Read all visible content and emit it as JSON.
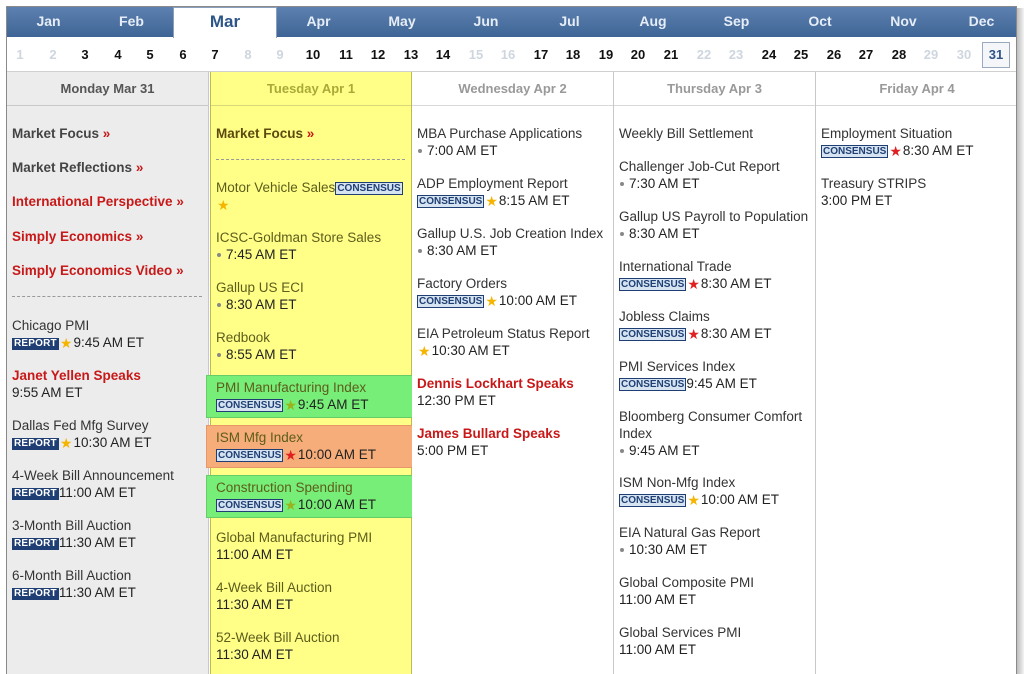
{
  "months": [
    {
      "label": "Jan",
      "active": false
    },
    {
      "label": "Feb",
      "active": false
    },
    {
      "label": "Mar",
      "active": true
    },
    {
      "label": "Apr",
      "active": false
    },
    {
      "label": "May",
      "active": false
    },
    {
      "label": "Jun",
      "active": false
    },
    {
      "label": "Jul",
      "active": false
    },
    {
      "label": "Aug",
      "active": false
    },
    {
      "label": "Sep",
      "active": false
    },
    {
      "label": "Oct",
      "active": false
    },
    {
      "label": "Nov",
      "active": false
    },
    {
      "label": "Dec",
      "active": false
    }
  ],
  "day_numbers": [
    {
      "n": "1",
      "muted": true
    },
    {
      "n": "2",
      "muted": true
    },
    {
      "n": "3"
    },
    {
      "n": "4"
    },
    {
      "n": "5"
    },
    {
      "n": "6"
    },
    {
      "n": "7"
    },
    {
      "n": "8",
      "muted": true
    },
    {
      "n": "9",
      "muted": true
    },
    {
      "n": "10"
    },
    {
      "n": "11"
    },
    {
      "n": "12"
    },
    {
      "n": "13"
    },
    {
      "n": "14"
    },
    {
      "n": "15",
      "muted": true
    },
    {
      "n": "16",
      "muted": true
    },
    {
      "n": "17"
    },
    {
      "n": "18"
    },
    {
      "n": "19"
    },
    {
      "n": "20"
    },
    {
      "n": "21"
    },
    {
      "n": "22",
      "muted": true
    },
    {
      "n": "23",
      "muted": true
    },
    {
      "n": "24"
    },
    {
      "n": "25"
    },
    {
      "n": "26"
    },
    {
      "n": "27"
    },
    {
      "n": "28"
    },
    {
      "n": "29",
      "muted": true
    },
    {
      "n": "30",
      "muted": true
    },
    {
      "n": "31",
      "selected": true
    }
  ],
  "arrow": "»",
  "monday": {
    "header": "Monday Mar 31",
    "links": [
      {
        "label": "Market Focus",
        "red": false
      },
      {
        "label": "Market Reflections",
        "red": false
      },
      {
        "label": "International Perspective",
        "red": true
      },
      {
        "label": "Simply Economics",
        "red": true
      },
      {
        "label": "Simply Economics Video",
        "red": true
      }
    ],
    "events": [
      {
        "title": "Chicago PMI",
        "tag": "REPORT",
        "star": "gold",
        "time": "9:45 AM ET"
      },
      {
        "title": "Janet Yellen Speaks",
        "red": true,
        "time": "9:55 AM ET"
      },
      {
        "title": "Dallas Fed Mfg Survey",
        "tag": "REPORT",
        "star": "gold",
        "time": "10:30 AM ET"
      },
      {
        "title": "4-Week Bill Announcement",
        "tag": "REPORT",
        "time": "11:00 AM ET"
      },
      {
        "title": "3-Month Bill Auction",
        "tag": "REPORT",
        "time": "11:30 AM ET"
      },
      {
        "title": "6-Month Bill Auction",
        "tag": "REPORT",
        "time": "11:30 AM ET"
      }
    ]
  },
  "tuesday": {
    "header": "Tuesday Apr 1",
    "link": "Market Focus",
    "events": [
      {
        "title": "Motor Vehicle Sales",
        "tag": "CONSENSUS",
        "star": "gold"
      },
      {
        "title": "ICSC-Goldman Store Sales",
        "dot": true,
        "time": "7:45 AM ET"
      },
      {
        "title": "Gallup US ECI",
        "dot": true,
        "time": "8:30 AM ET"
      },
      {
        "title": "Redbook",
        "dot": true,
        "time": "8:55 AM ET"
      },
      {
        "title": "PMI Manufacturing Index",
        "tag": "CONSENSUS",
        "star": "green",
        "time": "9:45 AM ET",
        "highlight": "green"
      },
      {
        "title": "ISM Mfg Index",
        "tag": "CONSENSUS",
        "star": "red",
        "time": "10:00 AM ET",
        "highlight": "orange"
      },
      {
        "title": "Construction Spending",
        "tag": "CONSENSUS",
        "star": "green",
        "time": "10:00 AM ET",
        "highlight": "green"
      },
      {
        "title": "Global Manufacturing PMI",
        "time": "11:00 AM ET"
      },
      {
        "title": "4-Week Bill Auction",
        "time": "11:30 AM ET"
      },
      {
        "title": "52-Week Bill Auction",
        "time": "11:30 AM ET"
      }
    ]
  },
  "wednesday": {
    "header": "Wednesday Apr 2",
    "events": [
      {
        "title": "MBA Purchase Applications",
        "dot": true,
        "time": "7:00 AM ET"
      },
      {
        "title": "ADP Employment Report",
        "tag": "CONSENSUS",
        "star": "gold",
        "time": "8:15 AM ET"
      },
      {
        "title": "Gallup U.S. Job Creation Index",
        "dot": true,
        "time": "8:30 AM ET"
      },
      {
        "title": "Factory Orders",
        "tag": "CONSENSUS",
        "star": "gold",
        "time": "10:00 AM ET"
      },
      {
        "title": "EIA Petroleum Status Report",
        "star": "gold",
        "time": "10:30 AM ET"
      },
      {
        "title": "Dennis Lockhart Speaks",
        "red": true,
        "time": "12:30 PM ET"
      },
      {
        "title": "James Bullard Speaks",
        "red": true,
        "time": "5:00 PM ET"
      }
    ]
  },
  "thursday": {
    "header": "Thursday Apr 3",
    "events": [
      {
        "title": "Weekly Bill Settlement"
      },
      {
        "title": "Challenger Job-Cut Report",
        "dot": true,
        "time": "7:30 AM ET"
      },
      {
        "title": "Gallup US Payroll to Population",
        "dot": true,
        "time": "8:30 AM ET"
      },
      {
        "title": "International Trade",
        "tag": "CONSENSUS",
        "star": "red",
        "time": "8:30 AM ET"
      },
      {
        "title": "Jobless Claims",
        "tag": "CONSENSUS",
        "star": "red",
        "time": "8:30 AM ET"
      },
      {
        "title": "PMI Services Index",
        "tag": "CONSENSUS",
        "time": "9:45 AM ET"
      },
      {
        "title": "Bloomberg Consumer Comfort Index",
        "dot": true,
        "time": "9:45 AM ET"
      },
      {
        "title": "ISM Non-Mfg Index",
        "tag": "CONSENSUS",
        "star": "gold",
        "time": "10:00 AM ET"
      },
      {
        "title": "EIA Natural Gas Report",
        "dot": true,
        "time": "10:30 AM ET"
      },
      {
        "title": "Global Composite PMI",
        "time": "11:00 AM ET"
      },
      {
        "title": "Global Services PMI",
        "time": "11:00 AM ET"
      }
    ]
  },
  "friday": {
    "header": "Friday Apr 4",
    "events": [
      {
        "title": "Employment Situation",
        "tag": "CONSENSUS",
        "star": "red",
        "time": "8:30 AM ET"
      },
      {
        "title": "Treasury STRIPS",
        "time": "3:00 PM ET"
      }
    ]
  }
}
